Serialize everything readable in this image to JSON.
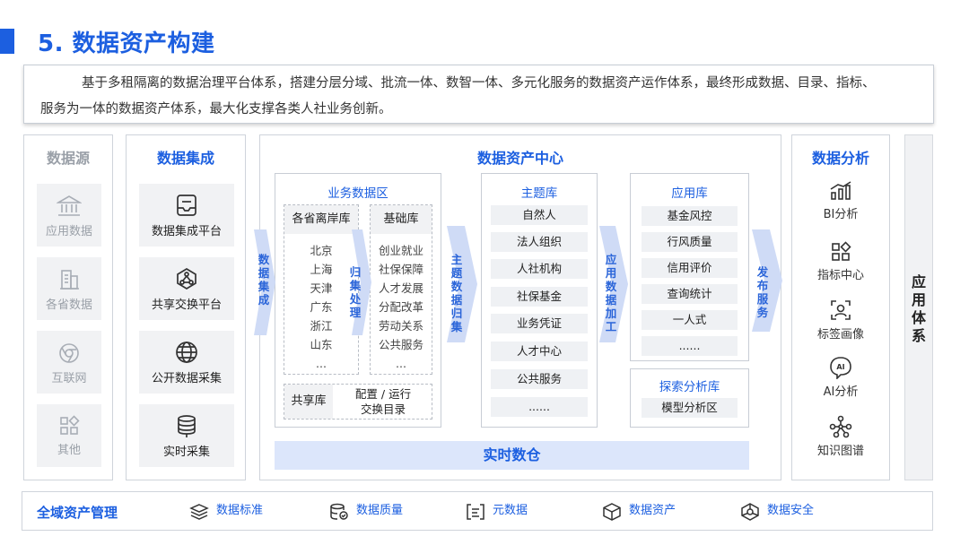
{
  "header": {
    "title": "5. 数据资产构建"
  },
  "intro": {
    "line1": "基于多租隔离的数据治理平台体系，搭建分层分域、批流一体、数智一体、多元化服务的数据资产运作体系，最终形成数据、目录、指标、",
    "line2": "服务为一体的数据资产体系，最大化支撑各类人社业务创新。"
  },
  "colors": {
    "accent": "#1c5fe0",
    "arrow": "#cfdbf6",
    "card_bg": "#f1f2f4",
    "warehouse_bg": "#dce6fb"
  },
  "data_source": {
    "title": "数据源",
    "items": [
      {
        "label": "应用数据",
        "icon": "bank-icon"
      },
      {
        "label": "各省数据",
        "icon": "building-icon"
      },
      {
        "label": "互联网",
        "icon": "chrome-icon"
      },
      {
        "label": "其他",
        "icon": "grid-icon"
      }
    ]
  },
  "integration": {
    "title": "数据集成",
    "items": [
      {
        "label": "数据集成平台",
        "icon": "inbox-icon"
      },
      {
        "label": "共享交换平台",
        "icon": "network-icon"
      },
      {
        "label": "公开数据采集",
        "icon": "globe-icon"
      },
      {
        "label": "实时采集",
        "icon": "database-icon"
      }
    ]
  },
  "asset_center": {
    "title": "数据资产中心",
    "business_zone": {
      "title": "业务数据区",
      "provinces": {
        "head": "各省离岸库",
        "items": [
          "北京",
          "上海",
          "天津",
          "广东",
          "浙江",
          "山东",
          "..."
        ]
      },
      "base": {
        "head": "基础库",
        "items": [
          "创业就业",
          "社保保障",
          "人才发展",
          "分配改革",
          "劳动关系",
          "公共服务",
          "..."
        ]
      },
      "shared": {
        "label": "共享库",
        "config_line1": "配置 / 运行",
        "config_line2": "交换目录"
      }
    },
    "topic_lib": {
      "title": "主题库",
      "items": [
        "自然人",
        "法人组织",
        "人社机构",
        "社保基金",
        "业务凭证",
        "人才中心",
        "公共服务",
        "......"
      ]
    },
    "app_lib": {
      "title": "应用库",
      "items": [
        "基金风控",
        "行风质量",
        "信用评价",
        "查询统计",
        "一人式",
        "......"
      ]
    },
    "explore_lib": {
      "title": "探索分析库",
      "items": [
        "模型分析区"
      ]
    },
    "warehouse": "实时数仓",
    "arrows": {
      "integrate": [
        "数",
        "据",
        "集",
        "成"
      ],
      "merge": [
        "归",
        "集",
        "处",
        "理"
      ],
      "topic_merge": [
        "主",
        "题",
        "数",
        "据",
        "归",
        "集"
      ],
      "app_process": [
        "应",
        "用",
        "数",
        "据",
        "加",
        "工"
      ],
      "publish": [
        "发",
        "布",
        "服",
        "务"
      ]
    }
  },
  "analysis": {
    "title": "数据分析",
    "items": [
      {
        "label": "BI分析",
        "icon": "bar-chart-icon"
      },
      {
        "label": "指标中心",
        "icon": "grid-diamond-icon"
      },
      {
        "label": "标签画像",
        "icon": "user-scan-icon"
      },
      {
        "label": "AI分析",
        "icon": "ai-icon"
      },
      {
        "label": "知识图谱",
        "icon": "graph-icon"
      }
    ]
  },
  "app_system": {
    "chars": [
      "应",
      "用",
      "体",
      "系"
    ]
  },
  "governance": {
    "title": "全域资产管理",
    "items": [
      {
        "label": "数据标准",
        "icon": "layers-icon"
      },
      {
        "label": "数据质量",
        "icon": "db-check-icon"
      },
      {
        "label": "元数据",
        "icon": "brackets-icon"
      },
      {
        "label": "数据资产",
        "icon": "cube-icon"
      },
      {
        "label": "数据安全",
        "icon": "security-icon"
      }
    ]
  }
}
